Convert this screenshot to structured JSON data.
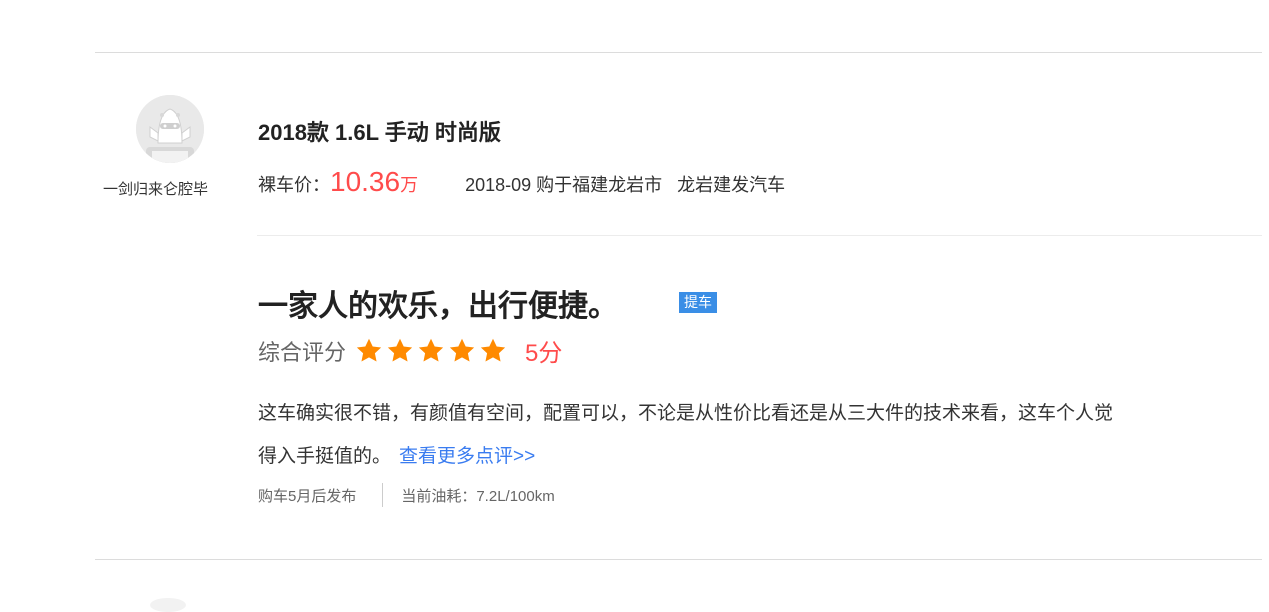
{
  "review_card": {
    "user": {
      "name": "一剑归来仑腔毕",
      "avatar_icon": "default-avatar-icon"
    },
    "car": {
      "trim": "2018款 1.6L 手动 时尚版",
      "price_label": "裸车价：",
      "price_value": "10.36",
      "price_unit": "万",
      "purchase_info": "2018-09  购于福建龙岩市",
      "dealer": "龙岩建发汽车"
    },
    "review": {
      "headline": "一家人的欢乐，出行便捷。",
      "tag": "提车",
      "rating_label": "综合评分",
      "rating_stars": 5,
      "rating_max": 5,
      "score_text": "5分",
      "body": "这车确实很不错，有颜值有空间，配置可以，不论是从性价比看还是从三大件的技术来看，这车个人觉得入手挺值的。",
      "more_link": "查看更多点评>>",
      "posted_info": "购车5月后发布",
      "fuel_info": "当前油耗：7.2L/100km"
    },
    "colors": {
      "price": "#ff4b4b",
      "star": "#ff8a00",
      "link": "#3a7cf0",
      "tag_bg": "#3a8ee6"
    }
  }
}
